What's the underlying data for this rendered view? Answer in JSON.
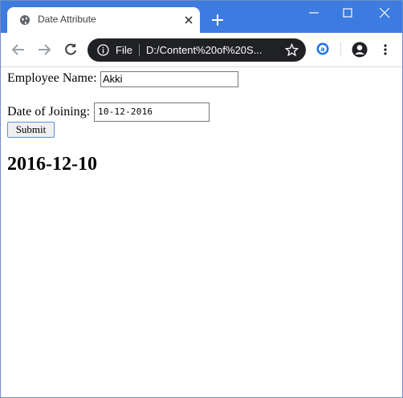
{
  "browser": {
    "tab_title": "Date Attribute",
    "omnibox_scheme": "File",
    "url": "D:/Content%20of%20S...",
    "accent": "#3c7be0"
  },
  "icons": [
    "globe-icon",
    "close-icon",
    "plus-icon",
    "minimize-icon",
    "maximize-icon",
    "window-close-icon",
    "back-icon",
    "forward-icon",
    "reload-icon",
    "info-icon",
    "star-icon",
    "extension-icon",
    "profile-icon",
    "menu-icon"
  ],
  "form": {
    "name_label": "Employee Name:",
    "name_value": "Akki",
    "doj_label": "Date of Joining:",
    "doj_value": "10-12-2016",
    "submit_label": "Submit"
  },
  "result": "2016-12-10"
}
